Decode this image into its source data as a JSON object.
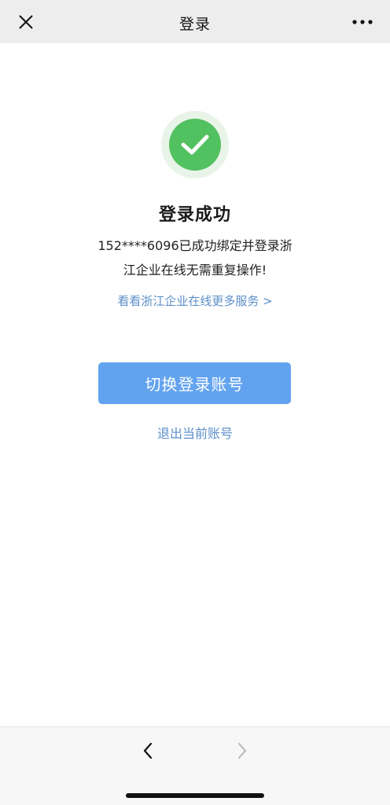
{
  "navbar": {
    "title": "登录",
    "close_icon": "close-icon",
    "more_icon": "more-dots-icon"
  },
  "result": {
    "status_icon": "check-circle-icon",
    "title": "登录成功",
    "description_line1": "152****6096已成功绑定并登录浙",
    "description_line2": "江企业在线无需重复操作!",
    "more_services_link": "看看浙江企业在线更多服务 >"
  },
  "actions": {
    "switch_account_label": "切换登录账号",
    "logout_label": "退出当前账号"
  },
  "bottombar": {
    "back_icon": "chevron-left-icon",
    "forward_icon": "chevron-right-icon"
  },
  "colors": {
    "success_green": "#52c160",
    "primary_button": "#62a3ef",
    "link_blue": "#5b8fc9",
    "navbar_bg": "#ededed"
  }
}
